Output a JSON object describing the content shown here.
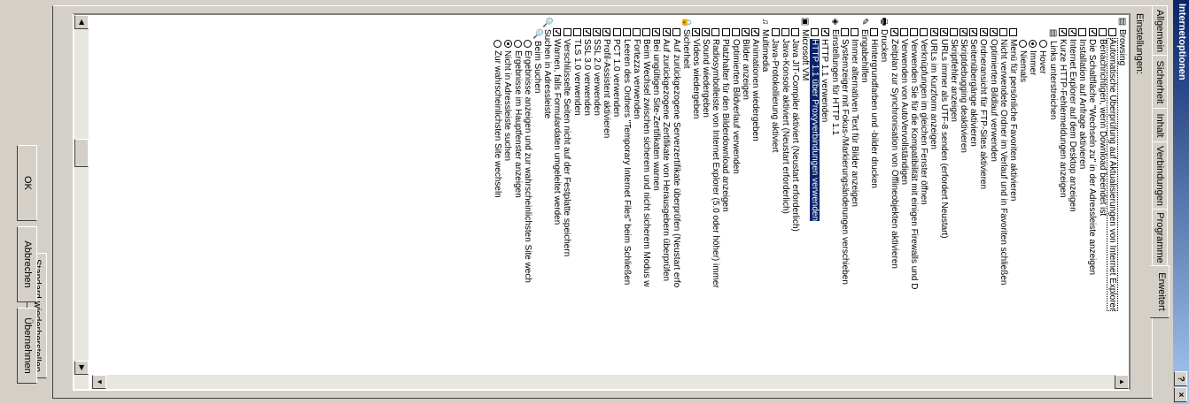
{
  "window": {
    "title": "Internetoptionen",
    "help_btn": "?",
    "close_btn": "×"
  },
  "tabs": [
    "Allgemein",
    "Sicherheit",
    "Inhalt",
    "Verbindungen",
    "Programme",
    "Erweitert"
  ],
  "settings_label": "Einstellungen:",
  "items": [
    {
      "type": "cat",
      "icon": "▤",
      "label": "Browsing"
    },
    {
      "type": "cb",
      "on": false,
      "label": "Automatische Überprüfung auf Aktualisierungen von Internet Explorer",
      "focus": true
    },
    {
      "type": "cb",
      "on": false,
      "label": "Benachrichtigen, wenn Download beendet ist"
    },
    {
      "type": "cb",
      "on": true,
      "label": "Die Schaltfläche \"Wechseln zu\" in der Adressleiste anzeigen"
    },
    {
      "type": "cb",
      "on": false,
      "label": "Installation auf Anfrage aktivieren"
    },
    {
      "type": "cb",
      "on": true,
      "label": "Internet Explorer auf dem Desktop anzeigen"
    },
    {
      "type": "cb",
      "on": true,
      "label": "Kurze HTTP-Fehlermeldungen anzeigen"
    },
    {
      "type": "cat",
      "icon": "▤",
      "label": "Links unterstreichen",
      "depth": 2
    },
    {
      "type": "rd",
      "on": false,
      "label": "Hover",
      "depth": 3
    },
    {
      "type": "rd",
      "on": true,
      "label": "Immer",
      "depth": 3
    },
    {
      "type": "rd",
      "on": false,
      "label": "Niemals",
      "depth": 3
    },
    {
      "type": "cb",
      "on": false,
      "label": "Menü für persönliche Favoriten aktivieren"
    },
    {
      "type": "cb",
      "on": false,
      "label": "Nicht verwendete Ordner im Verlauf und in Favoriten schließen"
    },
    {
      "type": "cb",
      "on": true,
      "label": "Optimierten Bildlauf verwenden"
    },
    {
      "type": "cb",
      "on": true,
      "label": "Ordneransicht für FTP-Sites aktivieren"
    },
    {
      "type": "cb",
      "on": true,
      "label": "Seitenübergänge aktivieren"
    },
    {
      "type": "cb",
      "on": true,
      "label": "Skriptdebugging deaktivieren"
    },
    {
      "type": "cb",
      "on": false,
      "label": "Skriptfehler anzeigen"
    },
    {
      "type": "cb",
      "on": true,
      "label": "URLs immer als UTF-8 senden (erfordert Neustart)"
    },
    {
      "type": "cb",
      "on": true,
      "label": "URLs im Kurzform anzeigen"
    },
    {
      "type": "cb",
      "on": false,
      "label": "Verknüpfungen im gleichen Fenster öffnen"
    },
    {
      "type": "cb",
      "on": false,
      "label": "Verwenden Sie für die Kompatibilität mit einigen Firewalls und D"
    },
    {
      "type": "cb",
      "on": false,
      "label": "Verwenden von AutoVervollständigen"
    },
    {
      "type": "cb",
      "on": true,
      "label": "Zeitplan zur Synchronisation von Offlineobjekten aktivieren"
    },
    {
      "type": "cat",
      "icon": "🖶",
      "label": "Drucken"
    },
    {
      "type": "cb",
      "on": false,
      "label": "Hintergrundfarben und -bilder drucken"
    },
    {
      "type": "cat",
      "icon": "✎",
      "label": "Eingabehilfen"
    },
    {
      "type": "cb",
      "on": false,
      "label": "Immer alternativen Text für Bilder anzeigen"
    },
    {
      "type": "cb",
      "on": false,
      "label": "Systemzeiger mit Fokus-/Markierungsänderungen verschieben"
    },
    {
      "type": "cat",
      "icon": "◈",
      "label": "Einstellungen für HTTP 1.1"
    },
    {
      "type": "cb",
      "on": true,
      "label": "HTTP 1.1 verwenden"
    },
    {
      "type": "cb",
      "on": false,
      "label": "HTTP 1.1 über Proxyverbindungen verwenden",
      "selected": true
    },
    {
      "type": "cat",
      "icon": "▣",
      "label": "Microsoft VM"
    },
    {
      "type": "cb",
      "on": false,
      "label": "Java JIT-Compiler aktiviert (Neustart erforderlich)"
    },
    {
      "type": "cb",
      "on": false,
      "label": "Java-Konsole aktiviert (Neustart erforderlich)"
    },
    {
      "type": "cb",
      "on": false,
      "label": "Java-Protokollierung aktiviert"
    },
    {
      "type": "cat",
      "icon": "♫",
      "label": "Multimedia"
    },
    {
      "type": "cb",
      "on": true,
      "label": "Animationen wiedergeben"
    },
    {
      "type": "cb",
      "on": true,
      "label": "Bilder anzeigen"
    },
    {
      "type": "cb",
      "on": false,
      "label": "Optimierten Bildverlauf verwenden"
    },
    {
      "type": "cb",
      "on": false,
      "label": "Platzhalter für den Bilderdownload anzeigen"
    },
    {
      "type": "cb",
      "on": false,
      "label": "Radiosymbolleiste von Internet Explorer (5.0 oder höher) immer"
    },
    {
      "type": "cb",
      "on": true,
      "label": "Sound wiedergeben"
    },
    {
      "type": "cb",
      "on": true,
      "label": "Videos wiedergeben"
    },
    {
      "type": "cat",
      "icon": "🔒",
      "label": "Sicherheit"
    },
    {
      "type": "cb",
      "on": false,
      "label": "Auf zurückgezogene Serverzertifikate überprüfen (Neustart erfo"
    },
    {
      "type": "cb",
      "on": true,
      "label": "Auf zurückgezogene Zertifikate von Herausgebern überprüfen"
    },
    {
      "type": "cb",
      "on": true,
      "label": "Bei ungültigen Site-Zertifikaten warnen"
    },
    {
      "type": "cb",
      "on": false,
      "label": "Beim Wechsel zwischen sicherem und nicht sicherem Modus w"
    },
    {
      "type": "cb",
      "on": false,
      "label": "Fortezza verwenden"
    },
    {
      "type": "cb",
      "on": false,
      "label": "Leeren des Ordners \"Temporary Internet Files\" beim Schließen"
    },
    {
      "type": "cb",
      "on": false,
      "label": "PCT 1.0 verwenden"
    },
    {
      "type": "cb",
      "on": true,
      "label": "Profil-Assistent aktivieren"
    },
    {
      "type": "cb",
      "on": true,
      "label": "SSL 2.0 verwenden"
    },
    {
      "type": "cb",
      "on": true,
      "label": "SSL 3.0 verwenden"
    },
    {
      "type": "cb",
      "on": false,
      "label": "TLS 1.0 verwenden"
    },
    {
      "type": "cb",
      "on": false,
      "label": "Verschlüsselte Seiten nicht auf der Festplatte speichern"
    },
    {
      "type": "cb",
      "on": true,
      "label": "Warnen, falls Formulardaten umgeleitet werden"
    },
    {
      "type": "cat",
      "icon": "🔍",
      "label": "Suchen in Adressleiste"
    },
    {
      "type": "cat",
      "icon": "🔍",
      "label": "Beim Suchen",
      "depth": 2
    },
    {
      "type": "rd",
      "on": false,
      "label": "Ergebnisse anzeigen und zur wahrscheinlichsten Site wech",
      "depth": 3
    },
    {
      "type": "rd",
      "on": false,
      "label": "Ergebnisse im Hauptfenster anzeigen",
      "depth": 3
    },
    {
      "type": "rd",
      "on": true,
      "label": "Nicht in Adressleiste suchen",
      "depth": 3
    },
    {
      "type": "rd",
      "on": false,
      "label": "Zur wahrscheinlichsten Site wechseln",
      "depth": 3
    }
  ],
  "restore_button": "Standard wiederherstellen",
  "ok_button": "OK",
  "cancel_button": "Abbrechen",
  "apply_button": "Übernehmen"
}
